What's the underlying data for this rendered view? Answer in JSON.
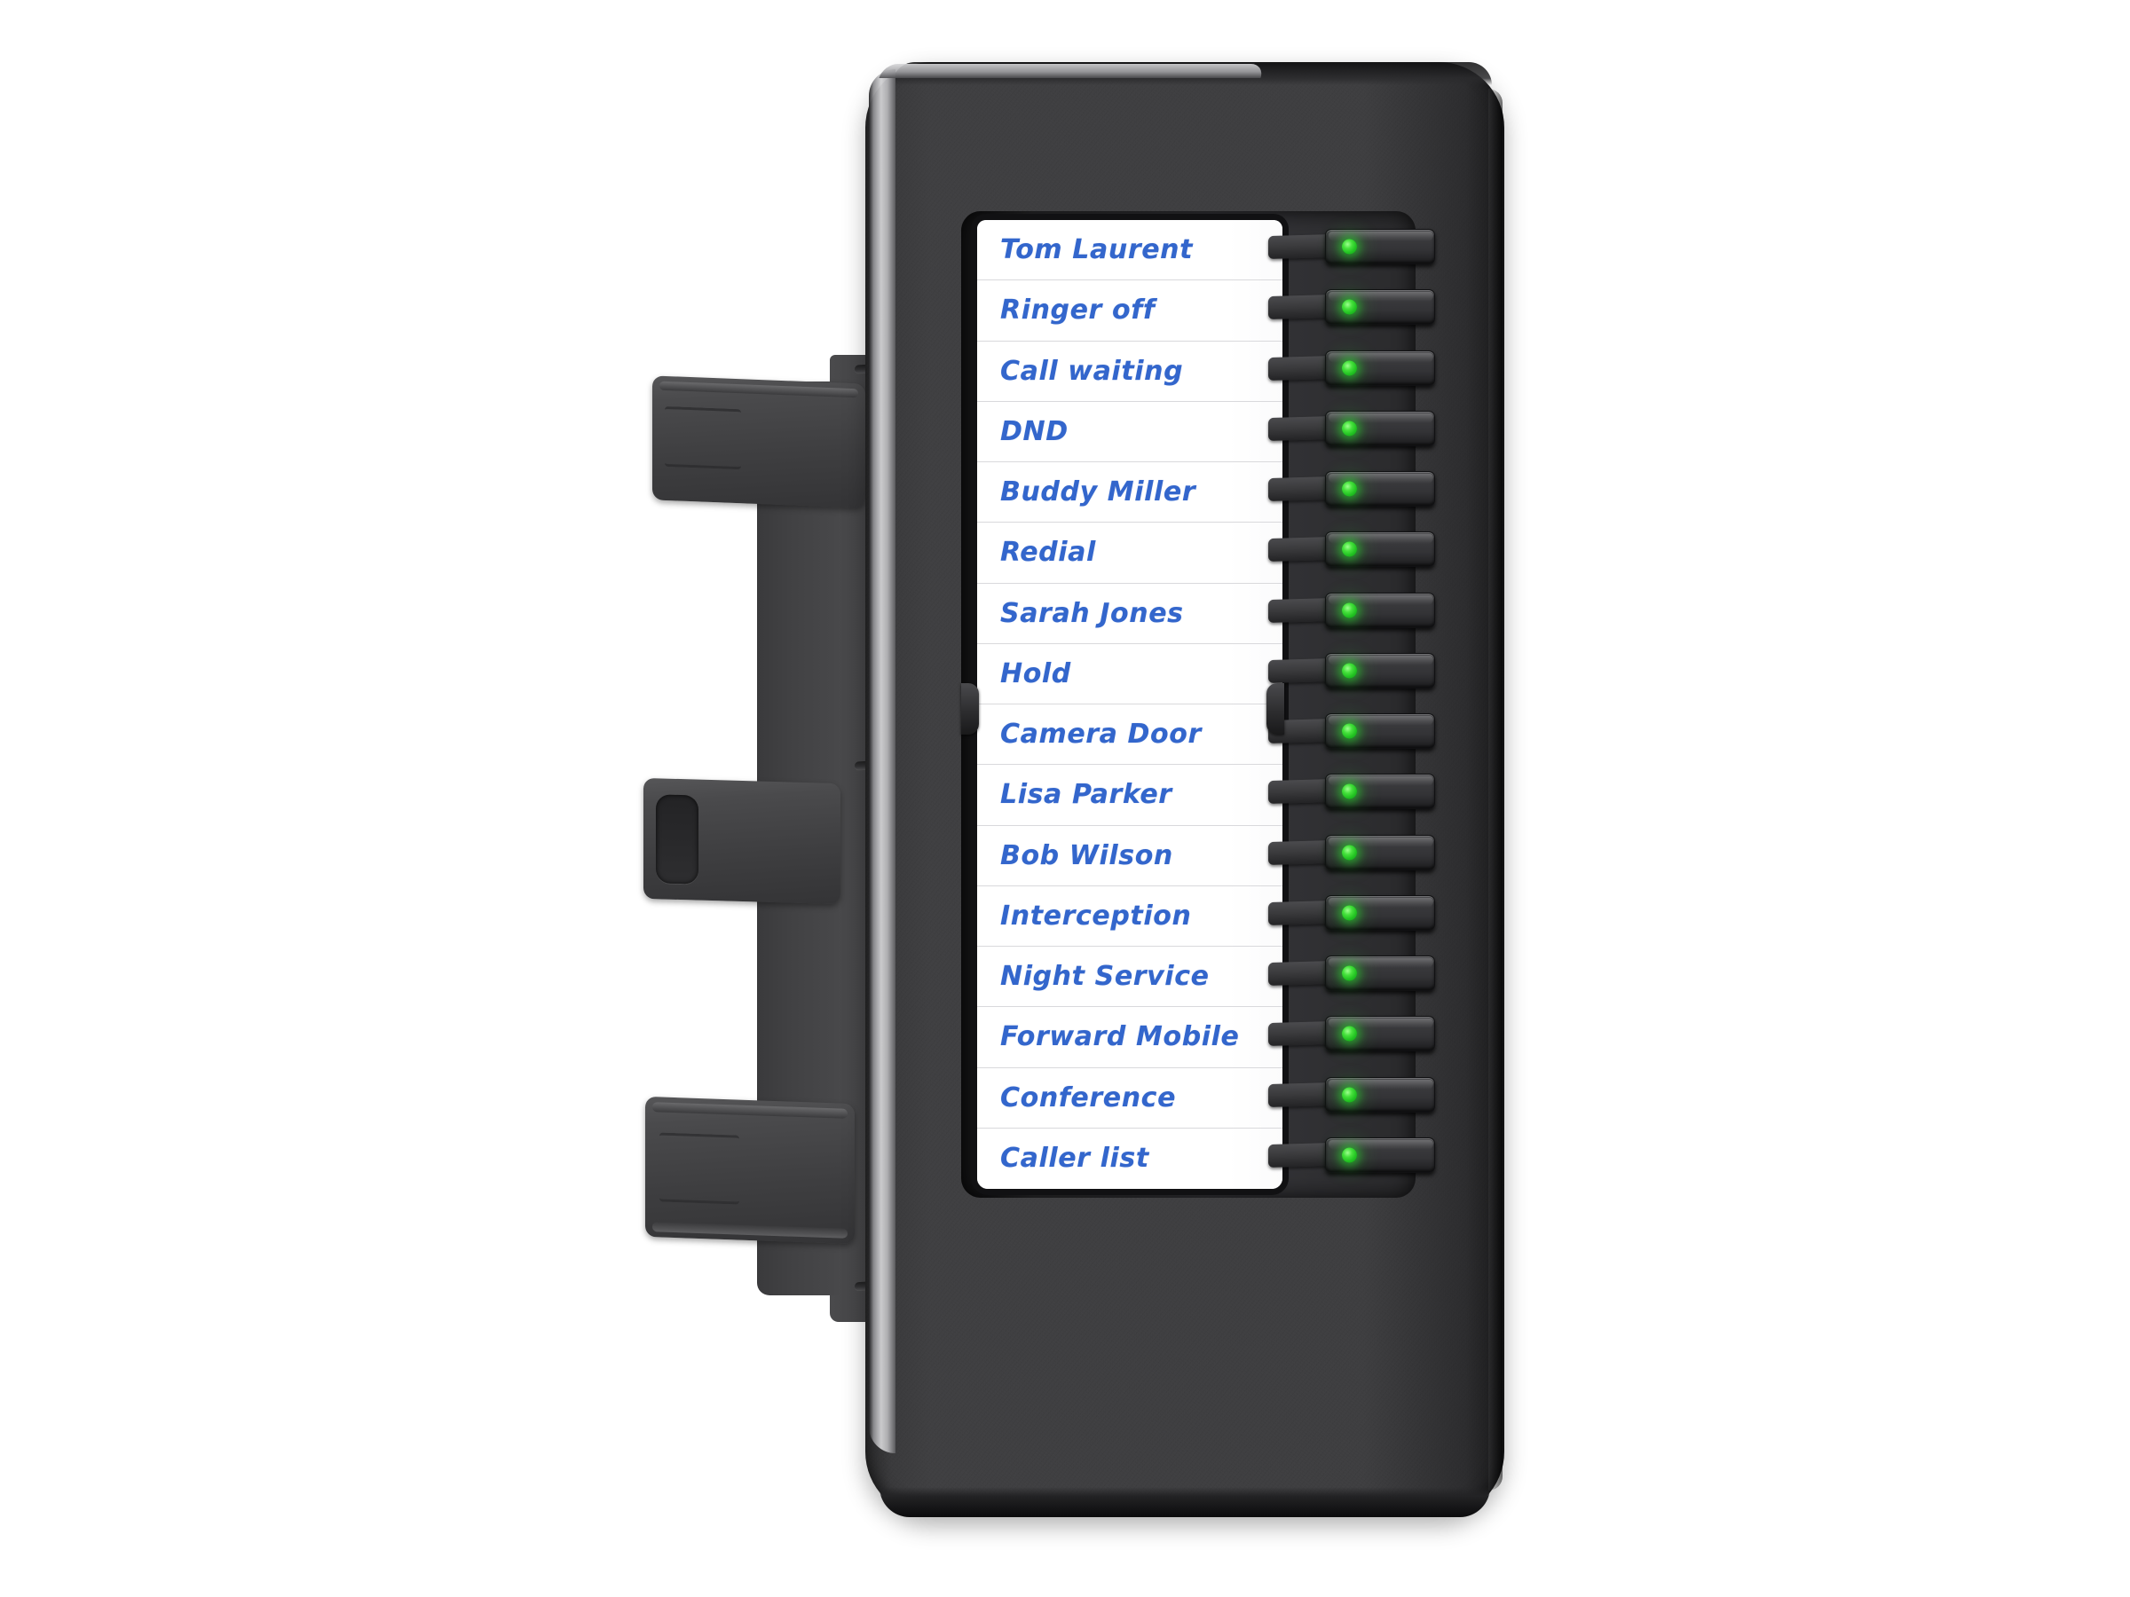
{
  "device": {
    "type": "voip-phone-expansion-module",
    "name": "Key expansion module",
    "body_color": "#3b3b3d",
    "chrome_accent": "#c8c8cb",
    "label_text_color": "#3366cc",
    "led_color": "#22c322",
    "label_card_color": "#ffffff",
    "key_count": 16
  },
  "keys": [
    {
      "index": 1,
      "label": "Tom Laurent",
      "led": "on"
    },
    {
      "index": 2,
      "label": "Ringer off",
      "led": "on"
    },
    {
      "index": 3,
      "label": "Call waiting",
      "led": "on"
    },
    {
      "index": 4,
      "label": "DND",
      "led": "on"
    },
    {
      "index": 5,
      "label": "Buddy Miller",
      "led": "on"
    },
    {
      "index": 6,
      "label": "Redial",
      "led": "on"
    },
    {
      "index": 7,
      "label": "Sarah Jones",
      "led": "on"
    },
    {
      "index": 8,
      "label": "Hold",
      "led": "on"
    },
    {
      "index": 9,
      "label": "Camera Door",
      "led": "on"
    },
    {
      "index": 10,
      "label": "Lisa Parker",
      "led": "on"
    },
    {
      "index": 11,
      "label": "Bob Wilson",
      "led": "on"
    },
    {
      "index": 12,
      "label": "Interception",
      "led": "on"
    },
    {
      "index": 13,
      "label": "Night Service",
      "led": "on"
    },
    {
      "index": 14,
      "label": "Forward Mobile",
      "led": "on"
    },
    {
      "index": 15,
      "label": "Conference",
      "led": "on"
    },
    {
      "index": 16,
      "label": "Caller list",
      "led": "on"
    }
  ],
  "bracket": {
    "name": "wall-mount-bracket",
    "tabs": [
      "upper-tab",
      "middle-tab-with-slot",
      "lower-tab"
    ],
    "hinge_pins": 2
  }
}
